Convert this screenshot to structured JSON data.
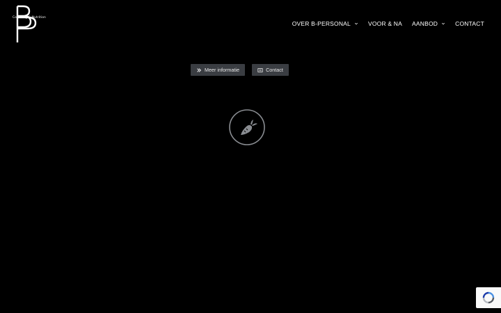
{
  "logo": {
    "letters": "BP",
    "tagline": "Coaching & Nutrition"
  },
  "nav": {
    "items": [
      {
        "label": "OVER B-PERSONAL",
        "has_dropdown": true
      },
      {
        "label": "VOOR & NA",
        "has_dropdown": false
      },
      {
        "label": "AANBOD",
        "has_dropdown": true
      },
      {
        "label": "CONTACT",
        "has_dropdown": false
      }
    ]
  },
  "buttons": {
    "info_label": "Meer informatie",
    "contact_label": "Contact"
  },
  "icons": {
    "info_button": "double-chevron-right-icon",
    "contact_button": "envelope-icon",
    "circle": "carrot-icon",
    "recaptcha": "recaptcha-icon"
  },
  "colors": {
    "background": "#000000",
    "button": "#3a3d42",
    "text": "#ffffff"
  }
}
